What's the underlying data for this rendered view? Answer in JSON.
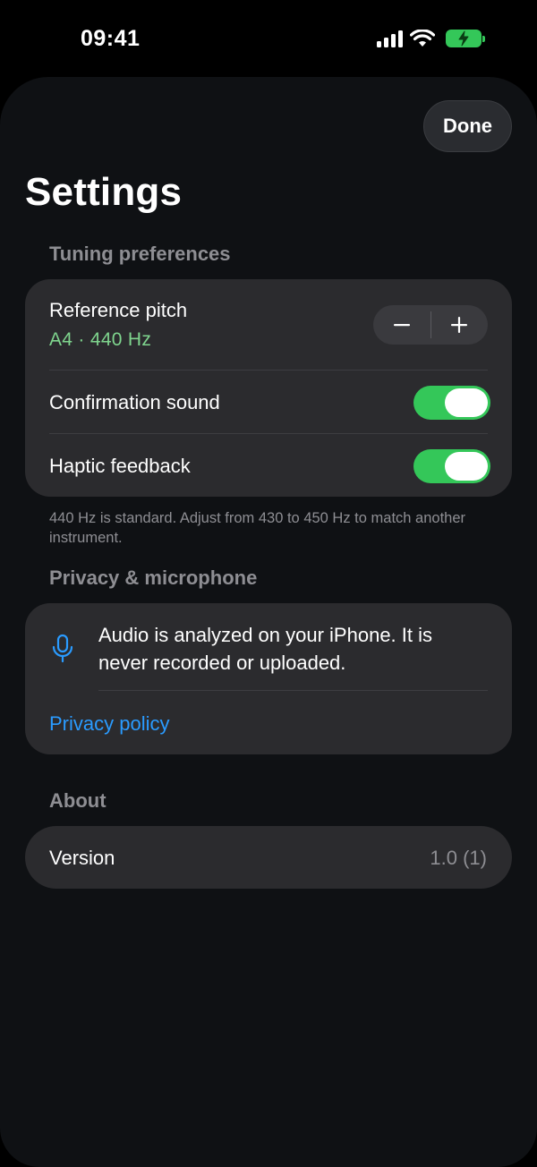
{
  "status_bar": {
    "time": "09:41",
    "icons": [
      "cellular-signal-icon",
      "wifi-icon",
      "battery-charging-icon"
    ],
    "battery_color": "#34c759"
  },
  "sheet": {
    "done_label": "Done",
    "title": "Settings"
  },
  "tuning": {
    "header": "Tuning preferences",
    "reference_pitch_label": "Reference pitch",
    "reference_pitch_value": "A4 · 440 Hz",
    "stepper_decrement": "−",
    "stepper_increment": "+",
    "confirmation_sound_label": "Confirmation sound",
    "confirmation_sound_on": true,
    "haptic_feedback_label": "Haptic feedback",
    "haptic_feedback_on": true,
    "footnote": "440 Hz is standard. Adjust from 430 to 450 Hz to match another instrument."
  },
  "privacy": {
    "header": "Privacy & microphone",
    "icon": "microphone-icon",
    "text": "Audio is analyzed on your iPhone. It is never recorded or uploaded.",
    "link_label": "Privacy policy",
    "link_color": "#2a9bff"
  },
  "about": {
    "header": "About",
    "version_label": "Version",
    "version_value": "1.0 (1)"
  },
  "colors": {
    "accent_green": "#34c759",
    "pitch_value_green": "#7fd58e",
    "background": "#0f1114",
    "card": "#2b2b2e"
  }
}
